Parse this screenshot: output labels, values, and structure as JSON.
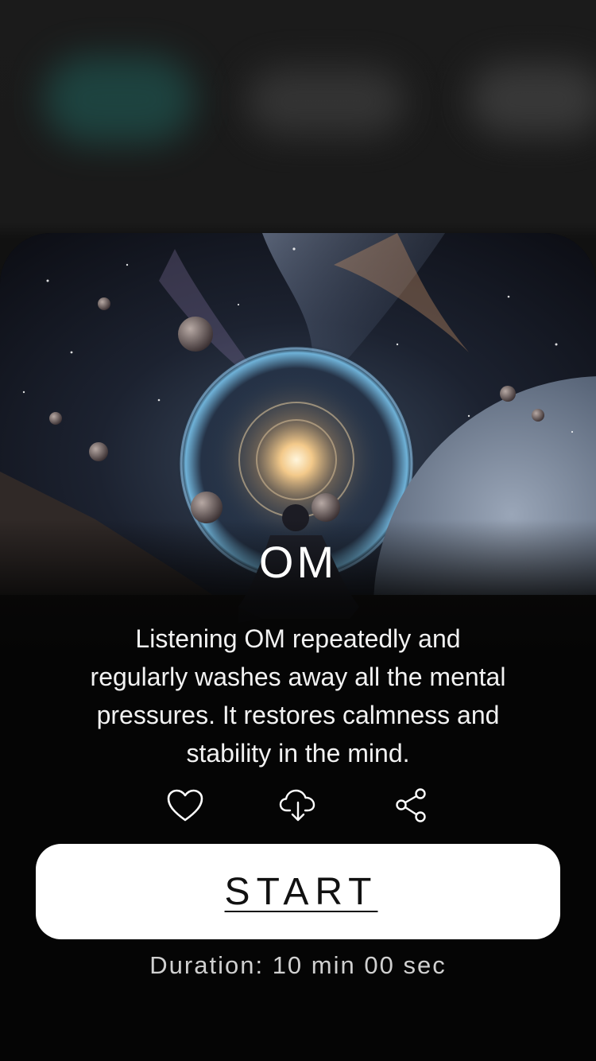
{
  "background": {
    "blurred_tiles": 3
  },
  "meditation": {
    "title": "OM",
    "description": "Listening OM repeatedly and regularly washes away all the mental pressures. It restores calmness and stability in the mind.",
    "image": "cosmic-meditation-artwork"
  },
  "actions": {
    "like_icon": "heart-outline-icon",
    "download_icon": "cloud-download-icon",
    "share_icon": "share-icon"
  },
  "start_button": {
    "label": "START"
  },
  "duration_text": "Duration: 10 min 00 sec",
  "colors": {
    "background": "#0a0a0a",
    "button": "#ffffff",
    "button_text": "#111111",
    "accent_glow": "#8fd3ff"
  }
}
